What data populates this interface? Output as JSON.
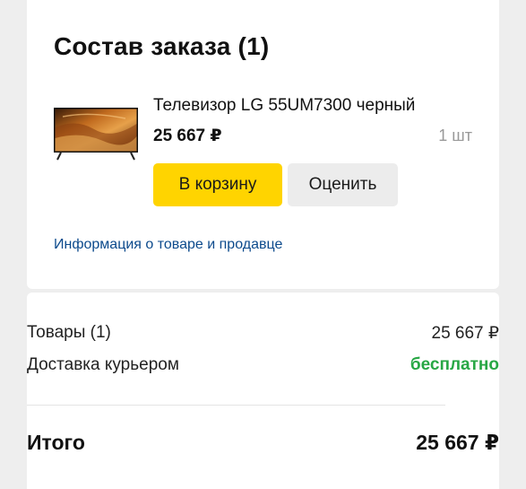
{
  "order": {
    "title": "Состав заказа (1)"
  },
  "product": {
    "name": "Телевизор LG 55UM7300 черный",
    "price": "25 667 ₽",
    "quantity": "1 шт",
    "add_to_cart_label": "В корзину",
    "rate_label": "Оценить"
  },
  "info_link": "Информация о товаре и продавце",
  "summary": {
    "goods_label": "Товары (1)",
    "goods_value": "25 667 ₽",
    "delivery_label": "Доставка курьером",
    "delivery_value": "бесплатно",
    "total_label": "Итого",
    "total_value": "25 667 ₽"
  },
  "colors": {
    "accent_button": "#ffd400",
    "link": "#0c4a8c",
    "free_delivery": "#28a745"
  },
  "icons": {
    "product_image": "tv-product-image"
  }
}
